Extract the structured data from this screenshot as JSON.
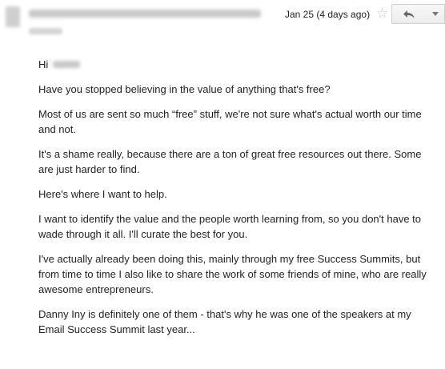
{
  "header": {
    "date": "Jan 25 (4 days ago)",
    "icons": {
      "star": "star-icon",
      "reply": "reply-arrow-icon",
      "more": "chevron-down-icon"
    }
  },
  "body": {
    "greeting": "Hi",
    "paragraphs": [
      "Have you stopped believing in the value of anything that's free?",
      "Most of us are sent so much “free” stuff, we're not sure what's actual worth our time and not.",
      "It's a shame really, because there are a ton of great free resources out there. Some are just harder to find.",
      "Here's where I want to help.",
      "I want to identify the value and the people worth learning from, so you don't have to wade through it all. I'll curate the best for you.",
      "I've actually already been doing this, mainly through my free Success Summits, but from time to time I also like to share the work of some friends of mine, who are really awesome entrepreneurs.",
      "Danny Iny is definitely one of them - that's why he was one of the speakers at my Email Success Summit last year..."
    ]
  }
}
